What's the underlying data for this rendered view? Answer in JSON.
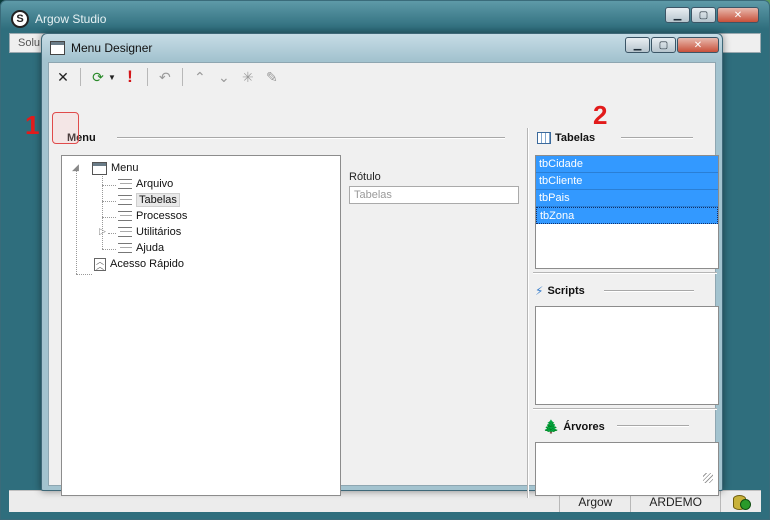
{
  "app": {
    "title": "Argow Studio",
    "logo_letter": "S",
    "menubar_visible_text": "Solu",
    "status": {
      "left": "Argow",
      "right": "ARDEMO",
      "db_icon": "database-connect-icon"
    }
  },
  "designer": {
    "title": "Menu Designer",
    "toolbar": [
      {
        "name": "delete-icon",
        "glyph": "✕"
      },
      {
        "name": "refresh-icon",
        "glyph": "⟳"
      },
      {
        "name": "exclamation-icon",
        "glyph": "!"
      },
      {
        "name": "undo-icon",
        "glyph": "↶"
      },
      {
        "name": "move-up-icon",
        "glyph": "⌃"
      },
      {
        "name": "move-down-icon",
        "glyph": "⌄"
      },
      {
        "name": "add-node-icon",
        "glyph": "✳"
      },
      {
        "name": "remove-node-icon",
        "glyph": "✎"
      }
    ],
    "menu_group": {
      "label": "Menu"
    },
    "tree": {
      "root": "Menu",
      "items": [
        "Arquivo",
        "Tabelas",
        "Processos",
        "Utilitários",
        "Ajuda"
      ],
      "selected": "Tabelas",
      "fast_access": "Acesso Rápido"
    },
    "rotulo": {
      "label": "Rótulo",
      "value": "Tabelas"
    },
    "tabelas": {
      "label": "Tabelas",
      "items": [
        "tbCidade",
        "tbCliente",
        "tbPais",
        "tbZona"
      ]
    },
    "scripts": {
      "label": "Scripts"
    },
    "arvores": {
      "label": "Árvores"
    }
  },
  "annotations": {
    "one": "1",
    "two": "2"
  },
  "colors": {
    "selection": "#3399ff",
    "annotation": "#e21b1b"
  }
}
